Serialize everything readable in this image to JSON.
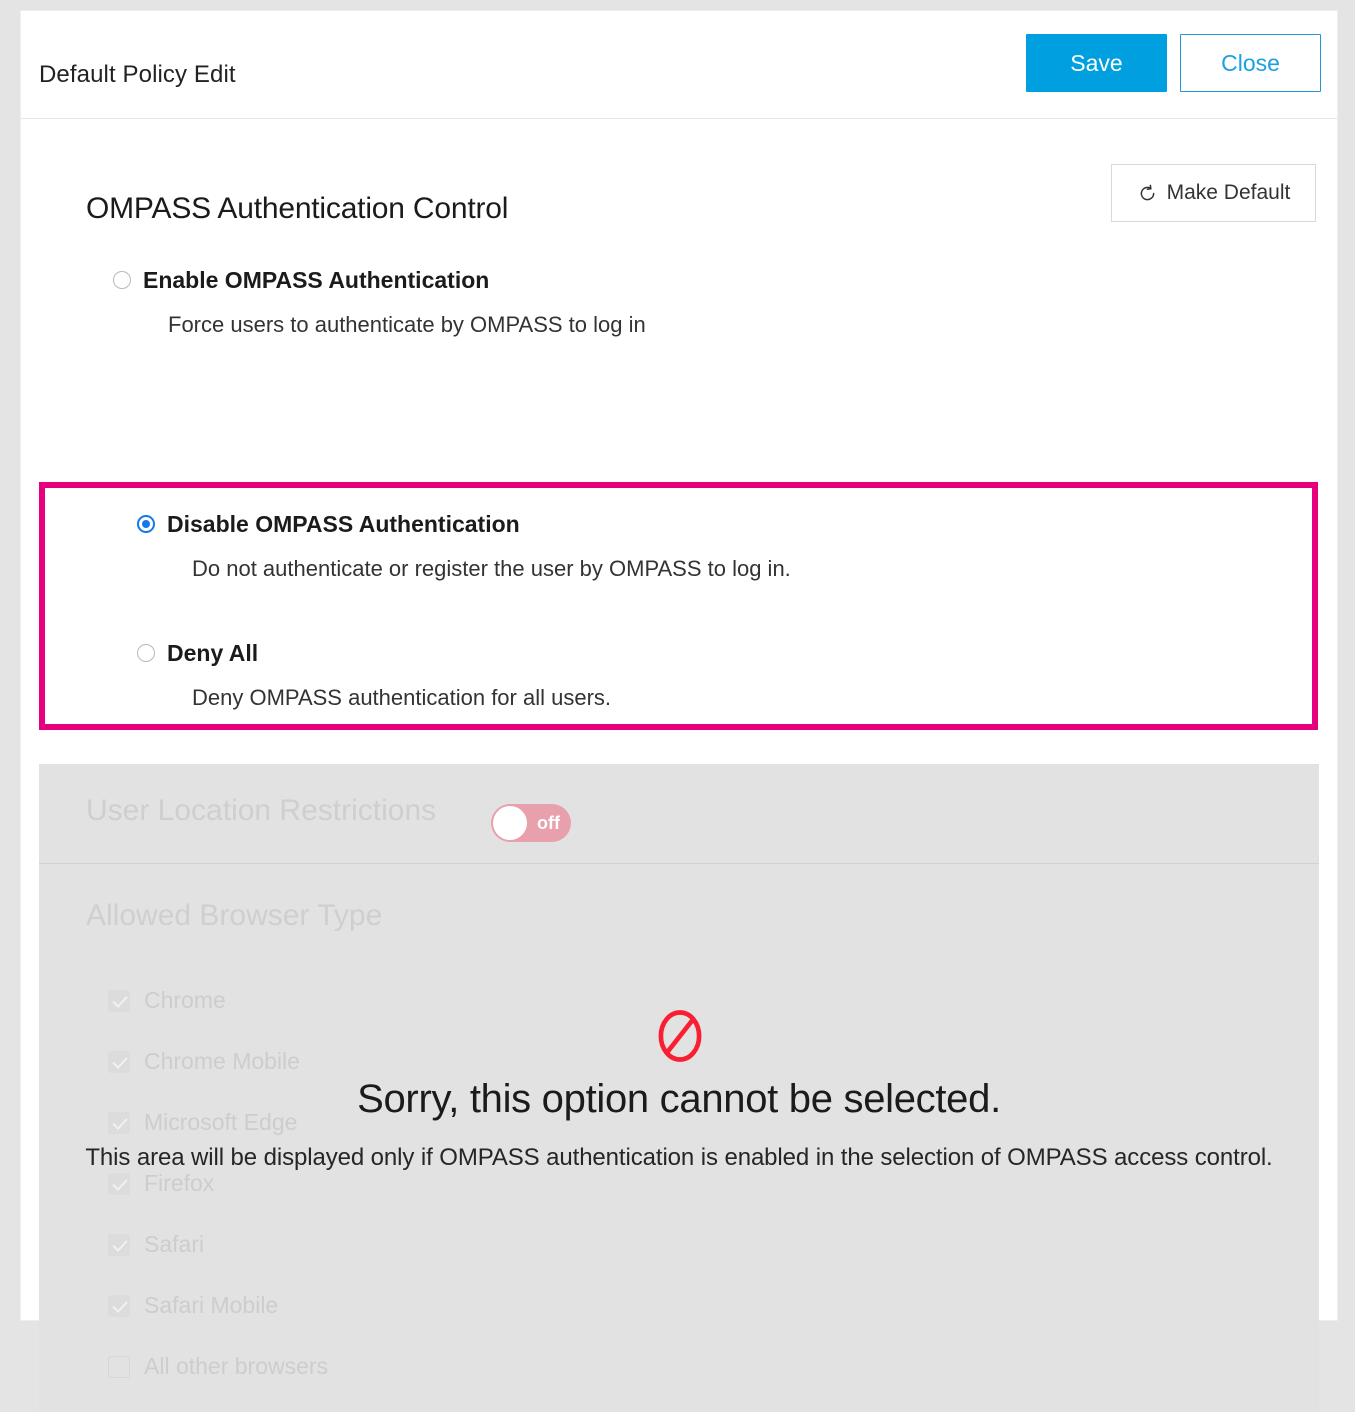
{
  "header": {
    "title": "Default Policy Edit",
    "save_label": "Save",
    "close_label": "Close",
    "accent_color": "#00a0e0"
  },
  "toolbar": {
    "make_default_label": "Make Default",
    "make_default_icon": "reset-circular-arrow-icon"
  },
  "auth_control": {
    "section_title": "OMPASS Authentication Control",
    "highlight_color": "#e6007e",
    "selected_value": "disable",
    "options": [
      {
        "value": "enable",
        "label": "Enable OMPASS Authentication",
        "description": "Force users to authenticate by OMPASS to log in",
        "selected": false
      },
      {
        "value": "disable",
        "label": "Disable OMPASS Authentication",
        "description": "Do not authenticate or register the user by OMPASS to log in.",
        "selected": true
      },
      {
        "value": "deny_all",
        "label": "Deny All",
        "description": "Deny OMPASS authentication for all users.",
        "selected": false
      }
    ]
  },
  "disabled_section": {
    "location_restrictions": {
      "label": "User Location Restrictions",
      "toggle_state": "off",
      "toggle_label": "off",
      "toggle_color": "#e8a0ac"
    },
    "allowed_browser_type": {
      "title": "Allowed Browser Type",
      "items": [
        {
          "label": "Chrome",
          "checked": true
        },
        {
          "label": "Chrome Mobile",
          "checked": true
        },
        {
          "label": "Microsoft Edge",
          "checked": true
        },
        {
          "label": "Firefox",
          "checked": true
        },
        {
          "label": "Safari",
          "checked": true
        },
        {
          "label": "Safari Mobile",
          "checked": true
        },
        {
          "label": "All other browsers",
          "checked": false
        }
      ]
    },
    "overlay": {
      "icon": "prohibition-no-entry-icon",
      "icon_color": "#fa1e32",
      "title": "Sorry, this option cannot be selected.",
      "note": "This area will be displayed only if OMPASS authentication is enabled in the selection of OMPASS access control."
    }
  }
}
